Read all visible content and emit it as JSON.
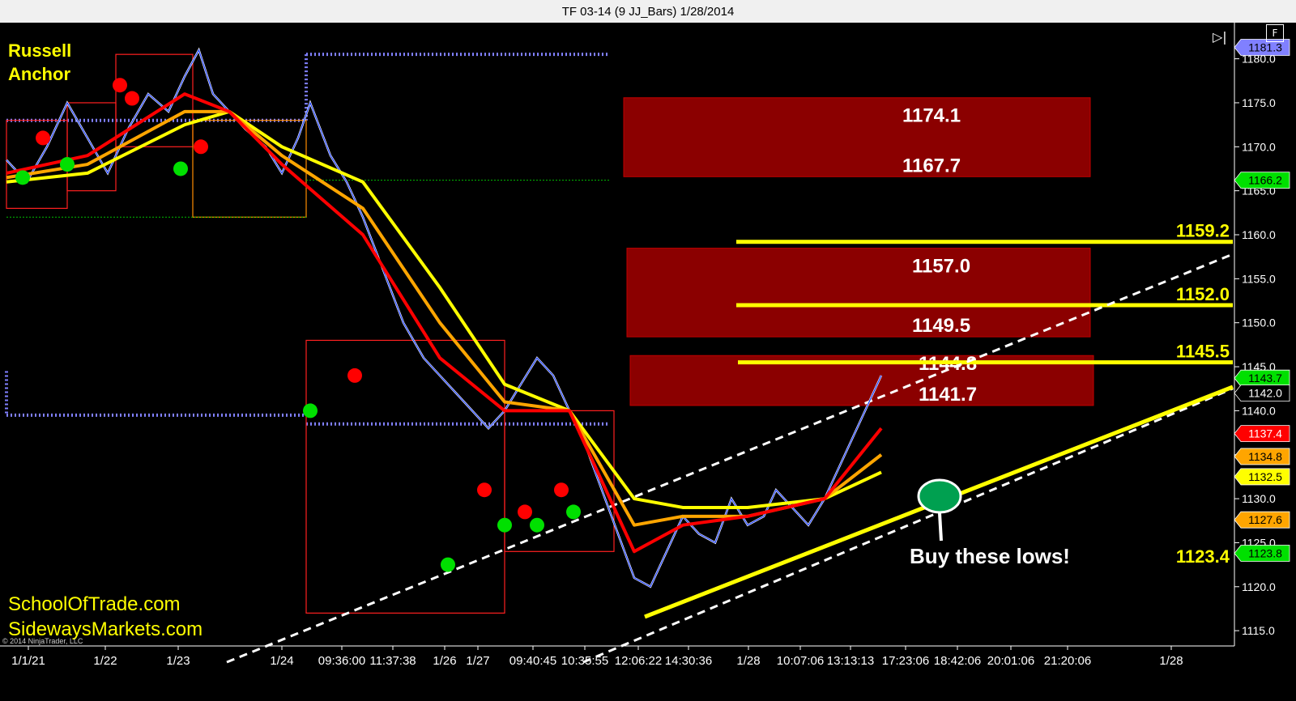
{
  "window": {
    "title": "TF 03-14 (9 JJ_Bars)  1/28/2014"
  },
  "controls": {
    "play_icon": "play-skip-icon",
    "f_button_label": "F"
  },
  "annotations": {
    "top_left": [
      "Russell",
      "Anchor"
    ],
    "bottom_left": [
      "SchoolOfTrade.com",
      "SidewaysMarkets.com"
    ],
    "copyright": "© 2014 NinjaTrader, LLC",
    "callout": "Buy these lows!"
  },
  "colors": {
    "background": "#000000",
    "zone_fill": "#8b0000",
    "yellow_line": "#ffff00",
    "anchor_dotted": "#8080ff",
    "buy_dot": "#00e000",
    "sell_dot": "#ff0000",
    "ma_fast": "#ff0000",
    "ma_mid": "#ffa500",
    "ma_slow": "#ffff00"
  },
  "chart_data": {
    "type": "line",
    "y_axis": {
      "range": [
        1114,
        1183
      ],
      "ticks": [
        "1115.0",
        "1120.0",
        "1125.0",
        "1130.0",
        "1135.0",
        "1140.0",
        "1145.0",
        "1150.0",
        "1155.0",
        "1160.0",
        "1165.0",
        "1170.0",
        "1175.0",
        "1180.0"
      ]
    },
    "x_axis": {
      "tick_labels": [
        "1/1/21",
        "1/22",
        "1/23",
        "1/24",
        "09:36:00",
        "11:37:38",
        "1/26",
        "1/27",
        "09:40:45",
        "10:35:55",
        "12:06:22",
        "14:30:36",
        "1/28",
        "10:07:06",
        "13:13:13",
        "17:23:06",
        "18:42:06",
        "20:01:06",
        "21:20:06",
        "1/28"
      ]
    },
    "price_series": {
      "name": "",
      "points": [
        [
          0,
          1168.5
        ],
        [
          10,
          1166
        ],
        [
          20,
          1170
        ],
        [
          30,
          1175
        ],
        [
          40,
          1171
        ],
        [
          50,
          1167
        ],
        [
          60,
          1172
        ],
        [
          70,
          1176
        ],
        [
          80,
          1174
        ],
        [
          88,
          1178
        ],
        [
          95,
          1181
        ],
        [
          102,
          1176
        ],
        [
          110,
          1174
        ],
        [
          118,
          1172
        ],
        [
          128,
          1170
        ],
        [
          136,
          1167
        ],
        [
          144,
          1171
        ],
        [
          150,
          1175
        ],
        [
          160,
          1169
        ],
        [
          168,
          1166
        ],
        [
          176,
          1162
        ],
        [
          186,
          1156
        ],
        [
          196,
          1150
        ],
        [
          206,
          1146
        ],
        [
          214,
          1144
        ],
        [
          222,
          1142
        ],
        [
          230,
          1140
        ],
        [
          238,
          1138
        ],
        [
          246,
          1140
        ],
        [
          254,
          1143
        ],
        [
          262,
          1146
        ],
        [
          270,
          1144
        ],
        [
          278,
          1140
        ],
        [
          286,
          1136
        ],
        [
          294,
          1131
        ],
        [
          302,
          1126
        ],
        [
          310,
          1121
        ],
        [
          318,
          1120
        ],
        [
          326,
          1124
        ],
        [
          334,
          1128
        ],
        [
          342,
          1126
        ],
        [
          350,
          1125
        ],
        [
          358,
          1130
        ],
        [
          366,
          1127
        ],
        [
          374,
          1128
        ],
        [
          380,
          1131
        ],
        [
          388,
          1129
        ],
        [
          396,
          1127
        ],
        [
          404,
          1130
        ],
        [
          412,
          1134
        ],
        [
          420,
          1138
        ],
        [
          428,
          1142
        ],
        [
          432,
          1144
        ]
      ]
    },
    "moving_averages": [
      {
        "name": "",
        "color": "#ff0000",
        "points": [
          [
            0,
            1167
          ],
          [
            40,
            1169
          ],
          [
            88,
            1176
          ],
          [
            110,
            1174
          ],
          [
            136,
            1168
          ],
          [
            176,
            1160
          ],
          [
            214,
            1146
          ],
          [
            246,
            1140
          ],
          [
            278,
            1140
          ],
          [
            310,
            1124
          ],
          [
            334,
            1127
          ],
          [
            366,
            1128
          ],
          [
            404,
            1130
          ],
          [
            432,
            1138
          ]
        ]
      },
      {
        "name": "",
        "color": "#ffa500",
        "points": [
          [
            0,
            1166.5
          ],
          [
            40,
            1168
          ],
          [
            88,
            1174
          ],
          [
            110,
            1174
          ],
          [
            136,
            1169
          ],
          [
            176,
            1163
          ],
          [
            214,
            1150
          ],
          [
            246,
            1141
          ],
          [
            278,
            1140
          ],
          [
            310,
            1127
          ],
          [
            334,
            1128
          ],
          [
            366,
            1128
          ],
          [
            404,
            1130
          ],
          [
            432,
            1135
          ]
        ]
      },
      {
        "name": "",
        "color": "#ffff00",
        "points": [
          [
            0,
            1166
          ],
          [
            40,
            1167
          ],
          [
            88,
            1172.5
          ],
          [
            110,
            1174
          ],
          [
            136,
            1170
          ],
          [
            176,
            1166
          ],
          [
            214,
            1154
          ],
          [
            246,
            1143
          ],
          [
            278,
            1140
          ],
          [
            310,
            1130
          ],
          [
            334,
            1129
          ],
          [
            366,
            1129
          ],
          [
            404,
            1130
          ],
          [
            432,
            1133
          ]
        ]
      }
    ],
    "signal_dots": {
      "buy": [
        [
          8,
          1166.5
        ],
        [
          30,
          1168
        ],
        [
          86,
          1167.5
        ],
        [
          150,
          1140
        ],
        [
          218,
          1122.5
        ],
        [
          246,
          1127
        ],
        [
          262,
          1127
        ],
        [
          280,
          1128.5
        ]
      ],
      "sell": [
        [
          18,
          1171
        ],
        [
          56,
          1177
        ],
        [
          62,
          1175.5
        ],
        [
          96,
          1170
        ],
        [
          172,
          1144
        ],
        [
          236,
          1131
        ],
        [
          256,
          1128.5
        ],
        [
          274,
          1131
        ]
      ]
    },
    "anchor_levels_dotted_blue": [
      {
        "from": 0,
        "to": 148,
        "value": 1173
      },
      {
        "from": 148,
        "to": 298,
        "value": 1180.5
      },
      {
        "from": 0,
        "to": 148,
        "value": 1139.5
      },
      {
        "from": 148,
        "to": 298,
        "value": 1138.5
      }
    ],
    "zones": [
      {
        "top": 1174.1,
        "bottom": 1167.7,
        "labels": [
          "1174.1",
          "1167.7"
        ]
      },
      {
        "top": 1157.0,
        "bottom": 1149.5,
        "labels": [
          "1157.0",
          "1149.5"
        ]
      },
      {
        "top": 1144.8,
        "bottom": 1141.7,
        "labels": [
          "1144.8",
          "1141.7"
        ]
      }
    ],
    "yellow_levels": [
      {
        "value": 1159.2,
        "label": "1159.2"
      },
      {
        "value": 1152.0,
        "label": "1152.0"
      },
      {
        "value": 1145.5,
        "label": "1145.5"
      },
      {
        "value": 1123.4,
        "label": "1123.4"
      }
    ],
    "price_tags": [
      {
        "value": 1181.3,
        "label": "1181.3",
        "color": "#8080ff"
      },
      {
        "value": 1166.2,
        "label": "1166.2",
        "color": "#00e000"
      },
      {
        "value": 1143.7,
        "label": "1143.7",
        "color": "#00e000"
      },
      {
        "value": 1142.0,
        "label": "1142.0",
        "color": "#000000"
      },
      {
        "value": 1137.4,
        "label": "1137.4",
        "color": "#ff0000"
      },
      {
        "value": 1134.8,
        "label": "1134.8",
        "color": "#ffa500"
      },
      {
        "value": 1132.5,
        "label": "1132.5",
        "color": "#ffff00"
      },
      {
        "value": 1127.6,
        "label": "1127.6",
        "color": "#ffa500"
      },
      {
        "value": 1123.8,
        "label": "1123.8",
        "color": "#00e000"
      }
    ]
  }
}
